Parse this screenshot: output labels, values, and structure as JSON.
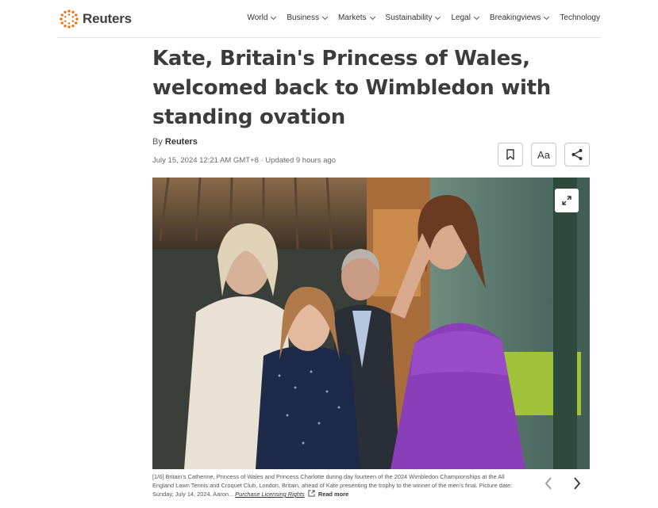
{
  "header": {
    "logo_text": "Reuters",
    "nav": [
      "World",
      "Business",
      "Markets",
      "Sustainability",
      "Legal",
      "Breakingviews",
      "Technology"
    ]
  },
  "article": {
    "headline": "Kate, Britain's Princess of Wales, welcomed back to Wimbledon with standing ovation",
    "byline_prefix": "By",
    "byline_author": "Reuters",
    "dateline": "July 15, 2024 12:21 AM GMT+8 · Updated 9 hours ago",
    "text_size_label": "Aa"
  },
  "photo": {
    "caption_index": "[1/6]",
    "caption": " Britain's Catherine, Princess of Wales and Princess Charlotte during day fourteen of the 2024 Wimbledon Championships at the All England Lawn Tennis and Croquet Club, London, Britain, ahead of Kate presenting the trophy to the winner of the men's final. Picture date: Sunday, July 14, 2024. Aaron... ",
    "licensing_link": "Purchase Licensing Rights",
    "read_more": "Read more"
  },
  "icons": {
    "bookmark": "bookmark-icon",
    "share": "share-icon",
    "expand": "expand-icon",
    "prev": "chevron-left-icon",
    "next": "chevron-right-icon",
    "external": "external-link-icon"
  },
  "colors": {
    "brand_orange": "#fa6400",
    "dress_purple": "#8a3fb8",
    "text_dark": "#3c3c3c"
  }
}
